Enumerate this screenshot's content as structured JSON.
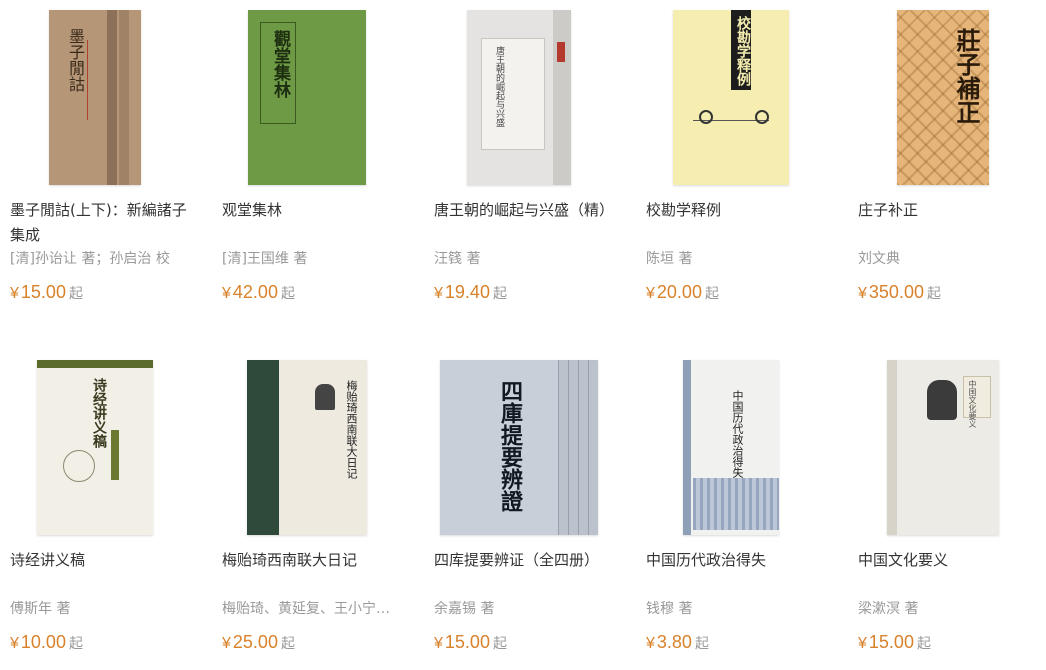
{
  "books": [
    {
      "title": "墨子閒詁(上下)：新編諸子集成",
      "author": "[清]孙诒让 著；孙启治 校",
      "price": "15.00",
      "price_prefix": "¥",
      "price_suffix": "起",
      "cover_text": "墨子閒詁"
    },
    {
      "title": "观堂集林",
      "author": "[清]王国维 著",
      "price": "42.00",
      "price_prefix": "¥",
      "price_suffix": "起",
      "cover_text": "觀堂集林"
    },
    {
      "title": "唐王朝的崛起与兴盛（精）",
      "author": "汪篯 著",
      "price": "19.40",
      "price_prefix": "¥",
      "price_suffix": "起",
      "cover_text": "唐王朝的崛起与兴盛"
    },
    {
      "title": "校勘学释例",
      "author": "陈垣 著",
      "price": "20.00",
      "price_prefix": "¥",
      "price_suffix": "起",
      "cover_text": "校勘学释例"
    },
    {
      "title": "庄子补正",
      "author": "刘文典",
      "price": "350.00",
      "price_prefix": "¥",
      "price_suffix": "起",
      "cover_text": "莊子補正"
    },
    {
      "title": "诗经讲义稿",
      "author": "傅斯年 著",
      "price": "10.00",
      "price_prefix": "¥",
      "price_suffix": "起",
      "cover_text": "诗经讲义稿"
    },
    {
      "title": "梅贻琦西南联大日记",
      "author": "梅贻琦、黄延复、王小宁 整理",
      "price": "25.00",
      "price_prefix": "¥",
      "price_suffix": "起",
      "cover_text": "梅贻琦西南联大日记"
    },
    {
      "title": "四库提要辨证（全四册）",
      "author": "余嘉锡 著",
      "price": "15.00",
      "price_prefix": "¥",
      "price_suffix": "起",
      "cover_text": "四庫提要辨證"
    },
    {
      "title": "中国历代政治得失",
      "author": "钱穆 著",
      "price": "3.80",
      "price_prefix": "¥",
      "price_suffix": "起",
      "cover_text": "中国历代政治得失"
    },
    {
      "title": "中国文化要义",
      "author": "梁漱溟 著",
      "price": "15.00",
      "price_prefix": "¥",
      "price_suffix": "起",
      "cover_text": "中国文化要义"
    }
  ],
  "colors": {
    "price": "#d9822b",
    "title": "#333333",
    "meta": "#999999"
  }
}
